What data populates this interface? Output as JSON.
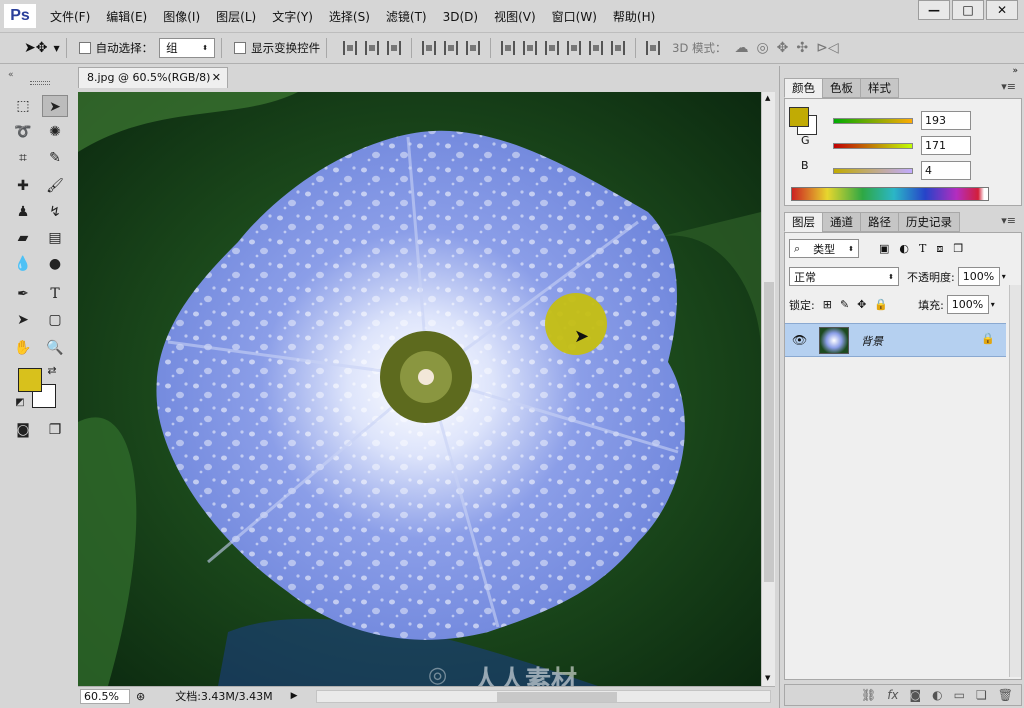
{
  "app": {
    "logo": "Ps"
  },
  "menu": [
    "文件(F)",
    "编辑(E)",
    "图像(I)",
    "图层(L)",
    "文字(Y)",
    "选择(S)",
    "滤镜(T)",
    "3D(D)",
    "视图(V)",
    "窗口(W)",
    "帮助(H)"
  ],
  "window_controls": {
    "minimize": "—",
    "maximize": "□",
    "close": "✕"
  },
  "options": {
    "auto_select_label": "自动选择：",
    "auto_select_value": "组",
    "show_transform_label": "显示变换控件",
    "mode_3d_label": "3D 模式："
  },
  "document": {
    "tab_title": "8.jpg @ 60.5%(RGB/8)",
    "zoom": "60.5%",
    "doc_size": "文档:3.43M/3.43M"
  },
  "toolbox": {
    "foreground_color": "#d8c11c",
    "background_color": "#ffffff"
  },
  "color_panel": {
    "tabs": [
      "颜色",
      "色板",
      "样式"
    ],
    "active_tab": "颜色",
    "r_label": "R",
    "r_value": "193",
    "g_label": "G",
    "g_value": "171",
    "b_label": "B",
    "b_value": "4",
    "swatch_color": "#c1ab04"
  },
  "layers_panel": {
    "tabs": [
      "图层",
      "通道",
      "路径",
      "历史记录"
    ],
    "active_tab": "图层",
    "filter_kind": "类型",
    "blend_mode": "正常",
    "opacity_label": "不透明度:",
    "opacity_value": "100%",
    "lock_label": "锁定:",
    "fill_label": "填充:",
    "fill_value": "100%",
    "layers": [
      {
        "name": "背景",
        "visible": true,
        "locked": true
      }
    ]
  },
  "layer_bottom_icons": [
    "link-icon",
    "fx-icon",
    "mask-icon",
    "adjustment-icon",
    "group-icon",
    "new-layer-icon",
    "trash-icon"
  ],
  "watermark": {
    "text": "人人素材"
  }
}
